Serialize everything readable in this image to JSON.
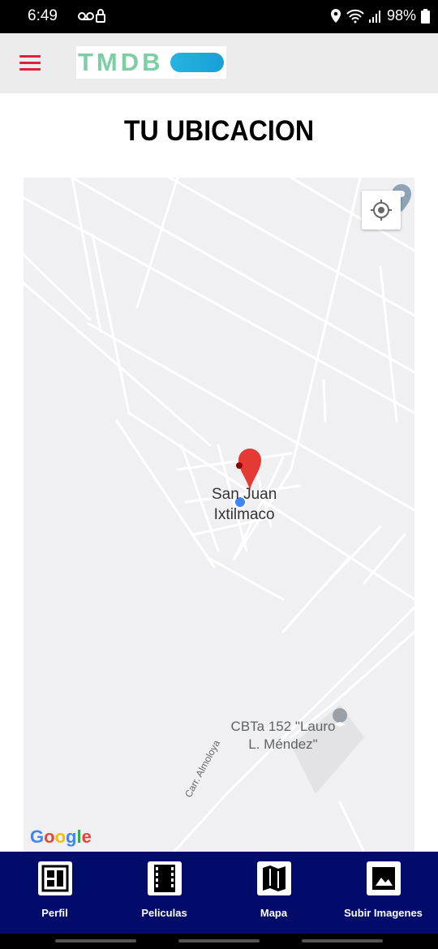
{
  "status": {
    "time": "6:49",
    "battery": "98%"
  },
  "header": {
    "logo_text": "TMDB"
  },
  "page": {
    "title": "TU UBICACION"
  },
  "map": {
    "town_line1": "San Juan",
    "town_line2": "Ixtilmaco",
    "school_line1": "CBTa 152 \"Lauro",
    "school_line2": "L. Méndez\"",
    "road_label": "Carr. Almoloya",
    "attribution": "Google",
    "marker_color": "#e53935",
    "user_dot_color": "#4285f4"
  },
  "nav": {
    "items": [
      {
        "label": "Perfil",
        "icon": "profile-icon"
      },
      {
        "label": "Peliculas",
        "icon": "film-icon"
      },
      {
        "label": "Mapa",
        "icon": "map-icon"
      },
      {
        "label": "Subir Imagenes",
        "icon": "image-icon"
      }
    ]
  },
  "colors": {
    "nav_bg": "#000b6a",
    "menu_accent": "#e0213b",
    "header_bg": "#ececec"
  }
}
